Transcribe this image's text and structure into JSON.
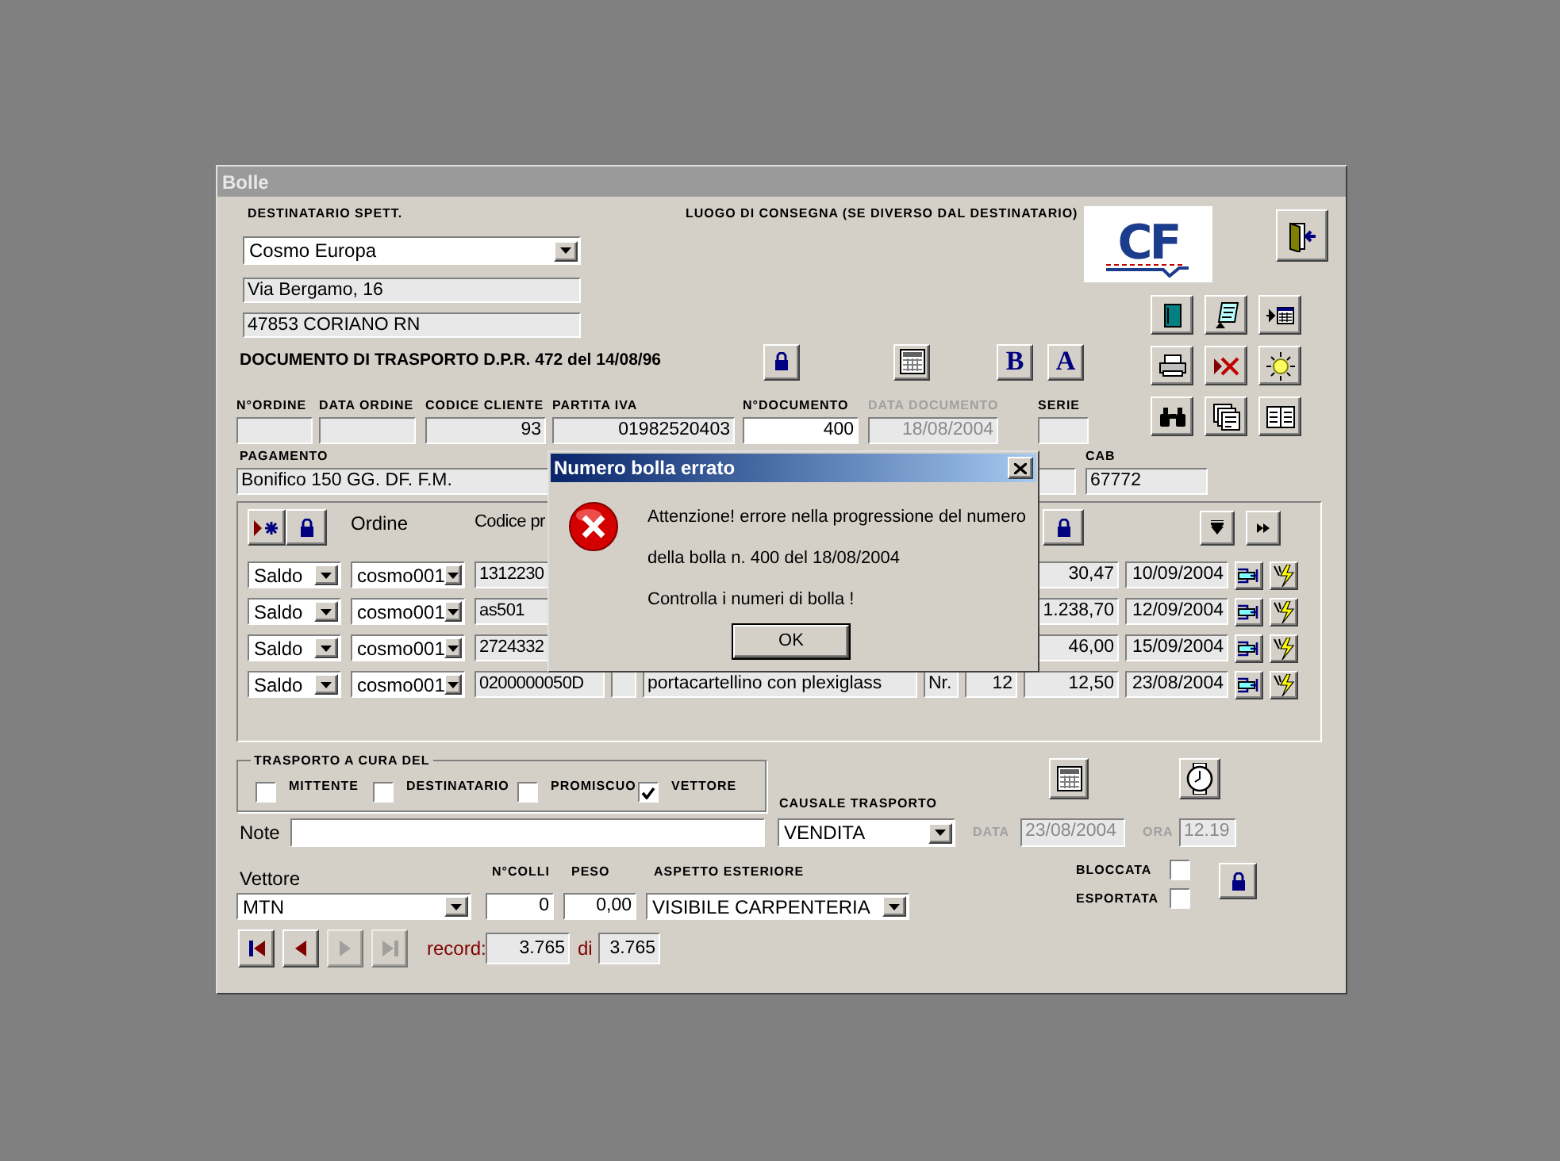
{
  "window": {
    "title": "Bolle"
  },
  "header": {
    "recipient_label": "DESTINATARIO SPETT.",
    "delivery_label": "LUOGO DI CONSEGNA (SE DIVERSO DAL DESTINATARIO)",
    "recipient": "Cosmo Europa",
    "address": "Via Bergamo, 16",
    "city": "47853 CORIANO RN",
    "logo_text": "CF"
  },
  "document_title": "DOCUMENTO DI TRASPORTO D.P.R. 472 del 14/08/96",
  "format_buttons": [
    "B",
    "A"
  ],
  "doc_fields": [
    {
      "label": "N°ORDINE",
      "kind": "readonly",
      "disabled": false
    },
    {
      "label": "DATA ORDINE",
      "kind": "readonly",
      "disabled": false
    },
    {
      "label": "CODICE CLIENTE",
      "kind": "readonly",
      "value": "93",
      "disabled": false
    },
    {
      "label": "PARTITA IVA",
      "kind": "readonly",
      "value": "01982520403",
      "disabled": false
    },
    {
      "label": "N°DOCUMENTO",
      "kind": "input",
      "value": "400",
      "disabled": false
    },
    {
      "label": "DATA DOCUMENTO",
      "kind": "readonly",
      "value": "18/08/2004",
      "disabled": true
    },
    {
      "label": "SERIE",
      "kind": "readonly",
      "disabled": false
    }
  ],
  "payment": {
    "label": "PAGAMENTO",
    "value": "Bonifico 150 GG. DF. F.M."
  },
  "cab": {
    "label": "CAB",
    "value": "67772"
  },
  "lines": {
    "columns": [
      "Ordine",
      "Codice pr"
    ],
    "rows": [
      {
        "type": "Saldo",
        "order": "cosmo001",
        "code": "1312230",
        "amount": "30,47",
        "date": "10/09/2004"
      },
      {
        "type": "Saldo",
        "order": "cosmo001",
        "code": "as501",
        "amount": "1.238,70",
        "date": "12/09/2004"
      },
      {
        "type": "Saldo",
        "order": "cosmo001",
        "code": "2724332",
        "amount": "46,00",
        "date": "15/09/2004"
      },
      {
        "type": "Saldo",
        "order": "cosmo001",
        "code": "0200000050D",
        "description": "portacartellino con plexiglass",
        "unit": "Nr.",
        "qty": "12",
        "amount": "12,50",
        "date": "23/08/2004"
      }
    ]
  },
  "transport": {
    "title": "TRASPORTO A CURA DEL",
    "options": [
      {
        "label": "MITTENTE",
        "checked": false
      },
      {
        "label": "DESTINATARIO",
        "checked": false
      },
      {
        "label": "PROMISCUO",
        "checked": false
      },
      {
        "label": "VETTORE",
        "checked": true
      }
    ]
  },
  "causale": {
    "label": "CAUSALE TRASPORTO",
    "value": "VENDITA"
  },
  "note_label": "Note",
  "date": {
    "label": "DATA",
    "value": "23/08/2004"
  },
  "time": {
    "label": "ORA",
    "value": "12.19"
  },
  "carrier": {
    "label": "Vettore",
    "value": "MTN"
  },
  "packages": {
    "label": "N°COLLI",
    "value": "0"
  },
  "weight": {
    "label": "PESO",
    "value": "0,00"
  },
  "appearance": {
    "label": "ASPETTO ESTERIORE",
    "value": "VISIBILE CARPENTERIA"
  },
  "flags": [
    {
      "label": "BLOCCATA",
      "checked": false
    },
    {
      "label": "ESPORTATA",
      "checked": false
    }
  ],
  "navigation": {
    "buttons": [
      {
        "kind": "first",
        "disabled": false
      },
      {
        "kind": "prev",
        "disabled": false
      },
      {
        "kind": "next",
        "disabled": true
      },
      {
        "kind": "last",
        "disabled": true
      }
    ],
    "record_label": "record:",
    "current": "3.765",
    "of_label": "di",
    "total": "3.765"
  },
  "dialog": {
    "title": "Numero bolla errato",
    "lines": [
      "Attenzione! errore nella progressione del numero",
      "della bolla n. 400 del 18/08/2004",
      "Controlla i numeri di bolla !"
    ],
    "button": "OK"
  }
}
